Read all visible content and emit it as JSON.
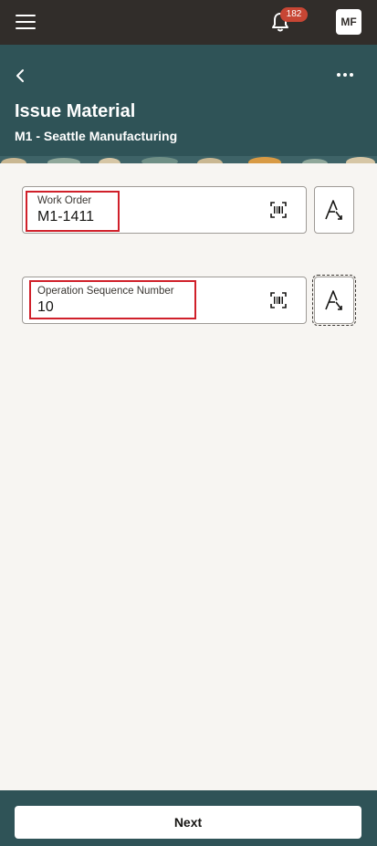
{
  "topbar": {
    "notification_count": "182",
    "avatar_initials": "MF"
  },
  "header": {
    "title": "Issue Material",
    "subtitle": "M1 - Seattle Manufacturing"
  },
  "fields": [
    {
      "label": "Work Order",
      "value": "M1-1411"
    },
    {
      "label": "Operation Sequence Number",
      "value": "10"
    }
  ],
  "footer": {
    "next_label": "Next"
  },
  "colors": {
    "topbar": "#312d2a",
    "header": "#2f5357",
    "badge": "#c74634",
    "highlight": "#d0202a",
    "background": "#f7f5f2"
  },
  "icons": [
    "menu-icon",
    "bell-icon",
    "back-icon",
    "more-icon",
    "barcode-scan-icon",
    "text-input-mode-icon"
  ]
}
